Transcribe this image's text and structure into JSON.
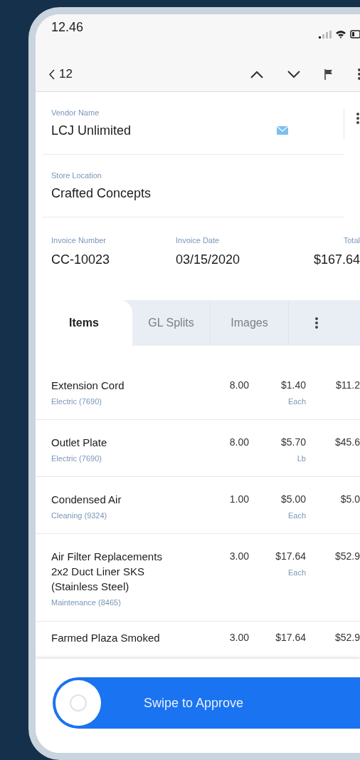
{
  "status_bar": {
    "time": "12.46"
  },
  "nav": {
    "back_label": "12"
  },
  "vendor": {
    "label": "Vendor Name",
    "value": "LCJ Unlimited"
  },
  "store": {
    "label": "Store Location",
    "value": "Crafted Concepts"
  },
  "invoice": [
    {
      "label": "Invoice Number",
      "value": "CC-10023"
    },
    {
      "label": "Invoice Date",
      "value": "03/15/2020"
    },
    {
      "label": "Total",
      "value": "$167.64"
    }
  ],
  "tabs": [
    {
      "label": "Items",
      "selected": true
    },
    {
      "label": "GL Splits",
      "selected": false
    },
    {
      "label": "Images",
      "selected": false
    }
  ],
  "items": [
    {
      "name": "Extension Cord",
      "category": "Electric (7690)",
      "qty": "8.00",
      "price": "$1.40",
      "unit": "Each",
      "total": "$11.2"
    },
    {
      "name": "Outlet Plate",
      "category": "Electric (7690)",
      "qty": "8.00",
      "price": "$5.70",
      "unit": "Lb",
      "total": "$45.6"
    },
    {
      "name": "Condensed Air",
      "category": "Cleaning (9324)",
      "qty": "1.00",
      "price": "$5.00",
      "unit": "Each",
      "total": "$5.0"
    },
    {
      "name": "Air Filter Replacements 2x2 Duct Liner SKS (Stainless Steel)",
      "category": "Maintenance (8465)",
      "qty": "3.00",
      "price": "$17.64",
      "unit": "Each",
      "total": "$52.9"
    },
    {
      "name": "Farmed Plaza Smoked",
      "qty": "3.00",
      "price": "$17.64",
      "total": "$52.9"
    }
  ],
  "swipe": {
    "label": "Swipe to Approve",
    "level": 0
  }
}
